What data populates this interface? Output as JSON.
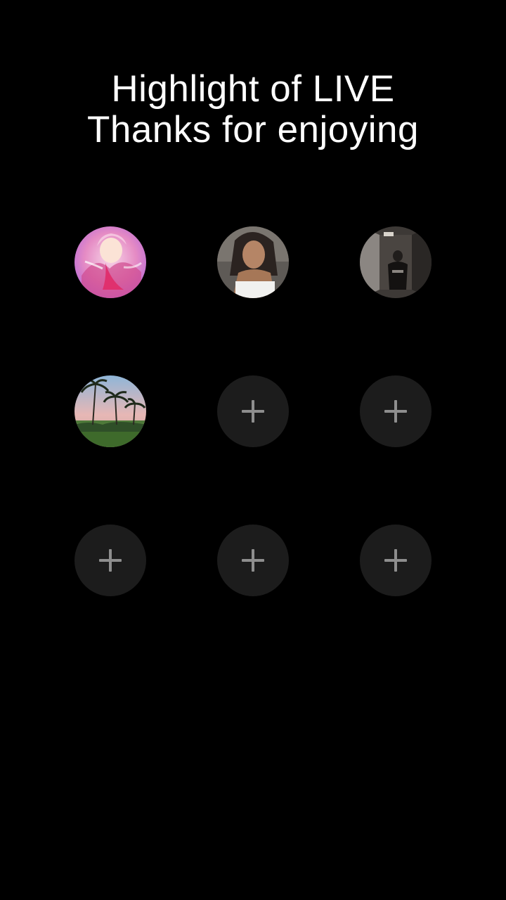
{
  "title": {
    "line1": "Highlight of LIVE",
    "line2": "Thanks for enjoying"
  },
  "colors": {
    "background": "#000000",
    "title_text": "#ffffff",
    "empty_slot": "#1c1c1c",
    "plus_icon": "#8e8e8e"
  },
  "slots": [
    {
      "type": "avatar",
      "icon": "anime-fairy-avatar"
    },
    {
      "type": "avatar",
      "icon": "woman-portrait-avatar"
    },
    {
      "type": "avatar",
      "icon": "person-in-hallway-avatar"
    },
    {
      "type": "avatar",
      "icon": "palm-trees-avatar"
    },
    {
      "type": "empty",
      "icon": "plus-icon"
    },
    {
      "type": "empty",
      "icon": "plus-icon"
    },
    {
      "type": "empty",
      "icon": "plus-icon"
    },
    {
      "type": "empty",
      "icon": "plus-icon"
    },
    {
      "type": "empty",
      "icon": "plus-icon"
    }
  ]
}
